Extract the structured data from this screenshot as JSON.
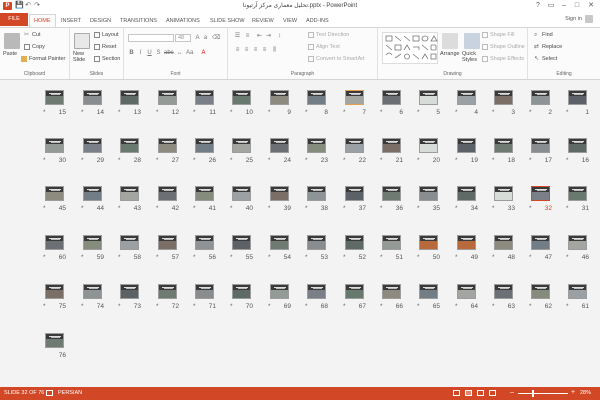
{
  "titlebar": {
    "app_icon": "P",
    "title": "تحلیل معماری مرکز آرتیونا.pptx - PowerPoint",
    "qat": {
      "save": "💾",
      "undo": "↶",
      "redo": "↷"
    },
    "win": {
      "help": "?",
      "restore": "▭",
      "minimize": "–",
      "maximize": "□",
      "close": "✕"
    }
  },
  "tabs": [
    "FILE",
    "HOME",
    "INSERT",
    "DESIGN",
    "TRANSITIONS",
    "ANIMATIONS",
    "SLIDE SHOW",
    "REVIEW",
    "VIEW",
    "ADD-INS"
  ],
  "signin": "Sign in",
  "ribbon": {
    "clipboard": {
      "paste": "Paste",
      "cut": "Cut",
      "copy": "Copy",
      "format_painter": "Format Painter",
      "label": "Clipboard"
    },
    "slides": {
      "new_slide": "New Slide",
      "layout": "Layout",
      "reset": "Reset",
      "section": "Section",
      "label": "Slides"
    },
    "font": {
      "size": "48",
      "label": "Font"
    },
    "paragraph": {
      "text_direction": "Text Direction",
      "align_text": "Align Text",
      "convert": "Convert to SmartArt",
      "label": "Paragraph"
    },
    "drawing": {
      "arrange": "Arrange",
      "quick_styles": "Quick Styles",
      "shape_fill": "Shape Fill",
      "shape_outline": "Shape Outline",
      "shape_effects": "Shape Effects",
      "label": "Drawing"
    },
    "editing": {
      "find": "Find",
      "replace": "Replace",
      "select": "Select",
      "label": "Editing"
    }
  },
  "slides": {
    "rows": [
      [
        "15",
        "14",
        "13",
        "12",
        "11",
        "10",
        "9",
        "8",
        "7",
        "6",
        "5",
        "4",
        "3",
        "2",
        "1"
      ],
      [
        "30",
        "29",
        "28",
        "27",
        "26",
        "25",
        "24",
        "23",
        "22",
        "21",
        "20",
        "19",
        "18",
        "17",
        "16"
      ],
      [
        "45",
        "44",
        "43",
        "42",
        "41",
        "40",
        "39",
        "38",
        "37",
        "36",
        "35",
        "34",
        "33",
        "32",
        "31"
      ],
      [
        "60",
        "59",
        "58",
        "57",
        "56",
        "55",
        "54",
        "53",
        "52",
        "51",
        "50",
        "49",
        "48",
        "47",
        "46"
      ],
      [
        "75",
        "74",
        "73",
        "72",
        "71",
        "70",
        "69",
        "68",
        "67",
        "66",
        "65",
        "64",
        "63",
        "62",
        "61"
      ],
      [
        "76"
      ]
    ],
    "star": "*",
    "selected": "32"
  },
  "statusbar": {
    "slide_info": "SLIDE 32 OF 76",
    "language": "PERSIAN",
    "zoom_minus": "–",
    "zoom_plus": "+",
    "zoom": "28%"
  },
  "colors": {
    "accent": "#d24726",
    "ribbon_bg": "#fbfbfb",
    "sorter_bg": "#f3f3f3"
  }
}
